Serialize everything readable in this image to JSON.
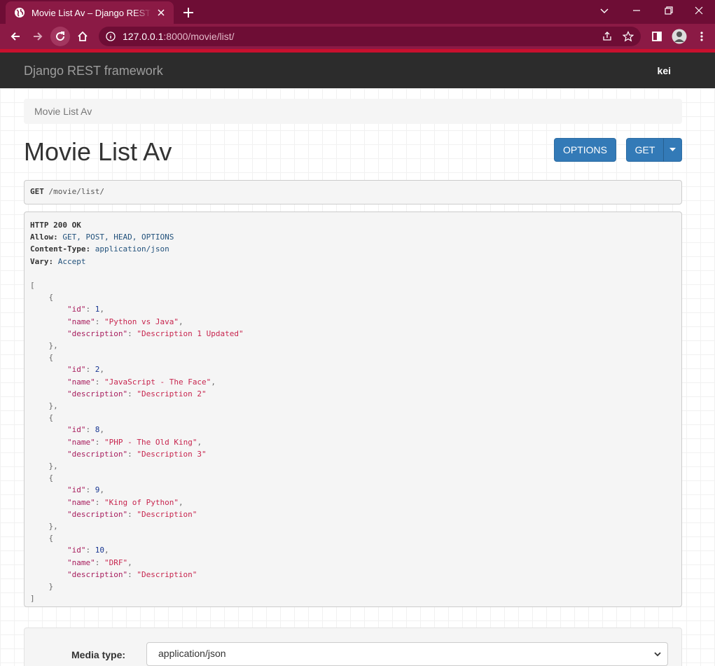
{
  "browser": {
    "tab_title": "Movie List Av – Django REST framework",
    "url_host": "127.0.0.1",
    "url_path": ":8000/movie/list/",
    "colors": {
      "tabbar": "#6e0d35",
      "toolbar": "#8b1a45"
    }
  },
  "navbar": {
    "brand": "Django REST framework",
    "user": "kei"
  },
  "breadcrumb": "Movie List Av",
  "page_title": "Movie List Av",
  "buttons": {
    "options": "OPTIONS",
    "get": "GET"
  },
  "request": {
    "method": "GET",
    "path": "/movie/list/"
  },
  "response": {
    "status": "HTTP 200 OK",
    "headers": [
      {
        "name": "Allow",
        "value": "GET, POST, HEAD, OPTIONS"
      },
      {
        "name": "Content-Type",
        "value": "application/json"
      },
      {
        "name": "Vary",
        "value": "Accept"
      }
    ],
    "body": [
      {
        "id": 1,
        "name": "Python vs Java",
        "description": "Description 1 Updated"
      },
      {
        "id": 2,
        "name": "JavaScript - The Face",
        "description": "Description 2"
      },
      {
        "id": 8,
        "name": "PHP - The Old King",
        "description": "Description 3"
      },
      {
        "id": 9,
        "name": "King of Python",
        "description": "Description"
      },
      {
        "id": 10,
        "name": "DRF",
        "description": "Description"
      }
    ]
  },
  "media": {
    "label": "Media type:",
    "selected": "application/json"
  }
}
